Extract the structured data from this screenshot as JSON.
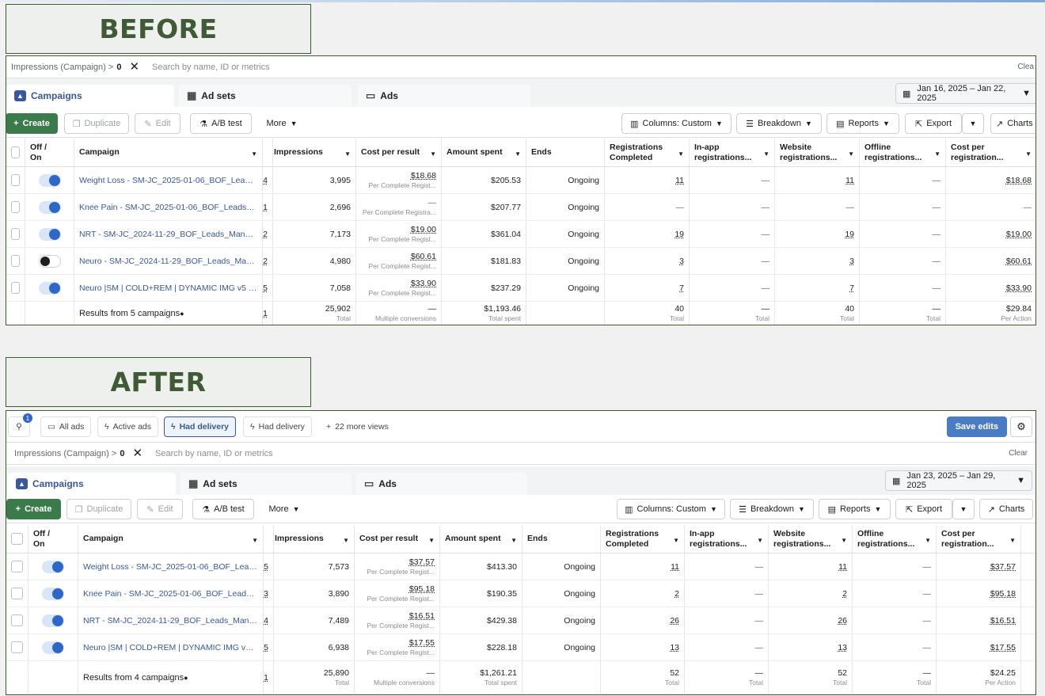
{
  "before_label": "BEFORE",
  "after_label": "AFTER",
  "filter": {
    "name": "Impressions (Campaign) >",
    "value": "0",
    "search_placeholder": "Search by name, ID or metrics",
    "before_clear": "Clea",
    "after_clear": "Clear"
  },
  "tabs": {
    "campaigns": "Campaigns",
    "adsets": "Ad sets",
    "ads": "Ads"
  },
  "before_date": "Jan 16, 2025 – Jan 22, 2025",
  "after_date": "Jan 23, 2025 – Jan 29, 2025",
  "toolbar": {
    "create": "Create",
    "duplicate": "Duplicate",
    "edit": "Edit",
    "ab_test": "A/B test",
    "more": "More",
    "columns": "Columns: Custom",
    "breakdown": "Breakdown",
    "reports": "Reports",
    "export": "Export",
    "charts": "Charts"
  },
  "views": {
    "badge": "1",
    "all_ads": "All ads",
    "active_ads": "Active ads",
    "had_delivery_1": "Had delivery",
    "had_delivery_2": "Had delivery",
    "more_views": "22 more views",
    "save_edits": "Save edits"
  },
  "headers": {
    "offon_1": "Off /",
    "offon_2": "On",
    "campaign": "Campaign",
    "impressions": "Impressions",
    "cost_per_result": "Cost per result",
    "amount_spent": "Amount spent",
    "ends": "Ends",
    "registrations": "Registrations Completed",
    "inapp": "In-app registrations...",
    "website": "Website registrations...",
    "offline": "Offline registrations...",
    "cost_per_reg": "Cost per registration..."
  },
  "before": {
    "rows": [
      {
        "on": true,
        "name": "Weight Loss - SM-JC_2025-01-06_BOF_Leads_...",
        "edge": "4",
        "impressions": "3,995",
        "cpr": "$18.68",
        "cpr_sub": "Per Complete Regist...",
        "spent": "$205.53",
        "ends": "Ongoing",
        "reg": "11",
        "inapp": "—",
        "web": "11",
        "off": "—",
        "cpreg": "$18.68"
      },
      {
        "on": true,
        "name": "Knee Pain - SM-JC_2025-01-06_BOF_Leads_Ma...",
        "edge": "1",
        "impressions": "2,696",
        "cpr": "—",
        "cpr_sub": "Per Complete Registra...",
        "spent": "$207.77",
        "ends": "Ongoing",
        "reg": "—",
        "inapp": "—",
        "web": "—",
        "off": "—",
        "cpreg": "—"
      },
      {
        "on": true,
        "name": "NRT - SM-JC_2024-11-29_BOF_Leads_Manual_...",
        "edge": "2",
        "impressions": "7,173",
        "cpr": "$19.00",
        "cpr_sub": "Per Complete Regist...",
        "spent": "$361.04",
        "ends": "Ongoing",
        "reg": "19",
        "inapp": "—",
        "web": "19",
        "off": "—",
        "cpreg": "$19.00"
      },
      {
        "on": false,
        "name": "Neuro - SM-JC_2024-11-29_BOF_Leads_Manua...",
        "edge": "2",
        "impressions": "4,980",
        "cpr": "$60.61",
        "cpr_sub": "Per Complete Regist...",
        "spent": "$181.83",
        "ends": "Ongoing",
        "reg": "3",
        "inapp": "—",
        "web": "3",
        "off": "—",
        "cpreg": "$60.61"
      },
      {
        "on": true,
        "name": "Neuro |SM | COLD+REM | DYNAMIC IMG v5 | JL",
        "edge": "5",
        "impressions": "7,058",
        "cpr": "$33.90",
        "cpr_sub": "Per Complete Regist...",
        "spent": "$237.29",
        "ends": "Ongoing",
        "reg": "7",
        "inapp": "—",
        "web": "7",
        "off": "—",
        "cpreg": "$33.90"
      }
    ],
    "total": {
      "label": "Results from 5 campaigns",
      "edge": "1",
      "impressions": "25,902",
      "imp_sub": "Total",
      "cpr": "—",
      "cpr_sub": "Multiple conversions",
      "spent": "$1,193.46",
      "spent_sub": "Total spent",
      "reg": "40",
      "reg_sub": "Total",
      "inapp": "—",
      "inapp_sub": "Total",
      "web": "40",
      "web_sub": "Total",
      "off": "—",
      "off_sub": "Total",
      "cpreg": "$29.84",
      "cpreg_sub": "Per Action"
    }
  },
  "after": {
    "rows": [
      {
        "on": true,
        "name": "Weight Loss - SM-JC_2025-01-06_BOF_Leads_...",
        "edge": "5",
        "impressions": "7,573",
        "cpr": "$37.57",
        "cpr_sub": "Per Complete Regist...",
        "spent": "$413.30",
        "ends": "Ongoing",
        "reg": "11",
        "inapp": "—",
        "web": "11",
        "off": "—",
        "cpreg": "$37.57"
      },
      {
        "on": true,
        "name": "Knee Pain - SM-JC_2025-01-06_BOF_Leads_Ma...",
        "edge": "3",
        "impressions": "3,890",
        "cpr": "$95.18",
        "cpr_sub": "Per Complete Regist...",
        "spent": "$190.35",
        "ends": "Ongoing",
        "reg": "2",
        "inapp": "—",
        "web": "2",
        "off": "—",
        "cpreg": "$95.18"
      },
      {
        "on": true,
        "name": "NRT - SM-JC_2024-11-29_BOF_Leads_Manual_...",
        "edge": "4",
        "impressions": "7,489",
        "cpr": "$16.51",
        "cpr_sub": "Per Complete Regist...",
        "spent": "$429.38",
        "ends": "Ongoing",
        "reg": "26",
        "inapp": "—",
        "web": "26",
        "off": "—",
        "cpreg": "$16.51"
      },
      {
        "on": true,
        "name": "Neuro |SM | COLD+REM | DYNAMIC IMG v5 | JL",
        "edge": "5",
        "impressions": "6,938",
        "cpr": "$17.55",
        "cpr_sub": "Per Complete Regist...",
        "spent": "$228.18",
        "ends": "Ongoing",
        "reg": "13",
        "inapp": "—",
        "web": "13",
        "off": "—",
        "cpreg": "$17.55"
      }
    ],
    "total": {
      "label": "Results from 4 campaigns",
      "edge": "1",
      "impressions": "25,890",
      "imp_sub": "Total",
      "cpr": "—",
      "cpr_sub": "Multiple conversions",
      "spent": "$1,261.21",
      "spent_sub": "Total spent",
      "reg": "52",
      "reg_sub": "Total",
      "inapp": "—",
      "inapp_sub": "Total",
      "web": "52",
      "web_sub": "Total",
      "off": "—",
      "off_sub": "Total",
      "cpreg": "$24.25",
      "cpreg_sub": "Per Action"
    }
  }
}
